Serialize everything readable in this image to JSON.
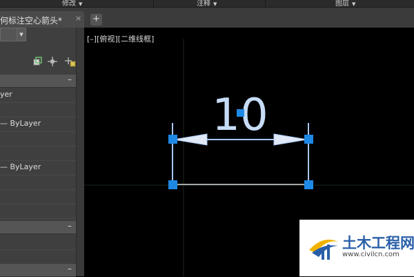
{
  "ribbon": {
    "panels": [
      {
        "label": "修改"
      },
      {
        "label": "注释"
      },
      {
        "label": "图层"
      }
    ]
  },
  "tab": {
    "title": "何标注空心箭头*",
    "close": "×",
    "new": "+"
  },
  "palette": {
    "section_collapse": "–",
    "rows": [
      {
        "value": "yer"
      },
      {
        "value": ""
      },
      {
        "value": "— ByLayer"
      },
      {
        "value": ""
      },
      {
        "value": ""
      },
      {
        "value": "— ByLayer"
      }
    ]
  },
  "viewport": {
    "label": "[–][俯视][二维线框]"
  },
  "dimension": {
    "text": "10"
  },
  "watermark": {
    "title": "土木工程网",
    "url": "www.civilcn.com"
  },
  "colors": {
    "grip": "#1e88e5",
    "dimension_line": "#a9c8f0",
    "background": "#000000",
    "palette": "#3f3f3f"
  }
}
